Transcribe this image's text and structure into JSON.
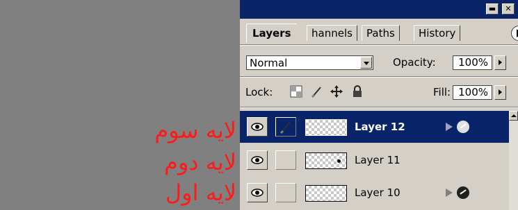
{
  "annotations": [
    "لایه سوم",
    "لایه دوم",
    "لایه اول"
  ],
  "panel": {
    "title_buttons": [
      "minimize-button",
      "close-button"
    ],
    "tabs": [
      {
        "label": "Layers",
        "active": true
      },
      {
        "label": "hannels",
        "active": false
      },
      {
        "label": "Paths",
        "active": false
      },
      {
        "label": "History",
        "active": false
      }
    ],
    "blend_mode": "Normal",
    "opacity_label": "Opacity:",
    "opacity_value": "100%",
    "lock_label": "Lock:",
    "lock_icons": [
      "lock-transparent-icon",
      "lock-paint-icon",
      "lock-move-icon",
      "lock-all-icon"
    ],
    "fill_label": "Fill:",
    "fill_value": "100%",
    "layers": [
      {
        "name": "Layer 12",
        "selected": true,
        "has_effects": true
      },
      {
        "name": "Layer 11",
        "selected": false,
        "has_effects": false
      },
      {
        "name": "Layer 10",
        "selected": false,
        "has_effects": true
      }
    ]
  },
  "colors": {
    "title_bar": "#0a246a",
    "panel_bg": "#d4d0c8",
    "canvas_gray": "#808080",
    "annotation_text": "#ff1a1a"
  }
}
